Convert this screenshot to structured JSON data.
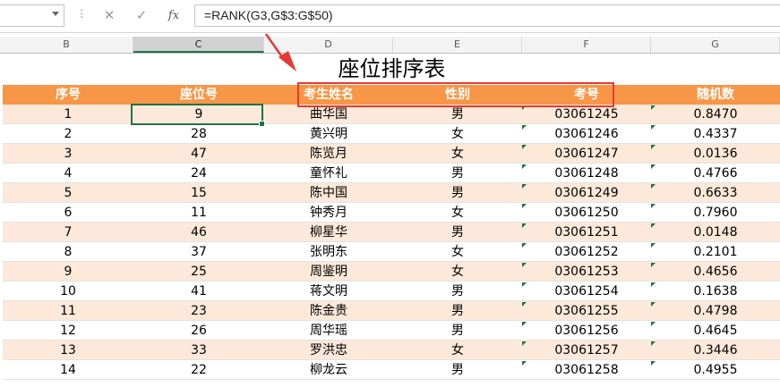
{
  "formula_bar": {
    "name_box": "",
    "cancel_icon": "✕",
    "enter_icon": "✓",
    "fx_label": "fx",
    "formula": "=RANK(G3,G$3:G$50)"
  },
  "columns": [
    "B",
    "C",
    "D",
    "E",
    "F",
    "G"
  ],
  "sheet": {
    "title": "座位排序表",
    "headers": [
      "序号",
      "座位号",
      "考生姓名",
      "性别",
      "考号",
      "随机数"
    ],
    "rows": [
      [
        "1",
        "9",
        "曲华国",
        "男",
        "03061245",
        "0.8470"
      ],
      [
        "2",
        "28",
        "黄兴明",
        "女",
        "03061246",
        "0.4337"
      ],
      [
        "3",
        "47",
        "陈览月",
        "女",
        "03061247",
        "0.0136"
      ],
      [
        "4",
        "24",
        "童怀礼",
        "男",
        "03061248",
        "0.4766"
      ],
      [
        "5",
        "15",
        "陈中国",
        "男",
        "03061249",
        "0.6633"
      ],
      [
        "6",
        "11",
        "钟秀月",
        "女",
        "03061250",
        "0.7960"
      ],
      [
        "7",
        "46",
        "柳星华",
        "男",
        "03061251",
        "0.0148"
      ],
      [
        "8",
        "37",
        "张明东",
        "女",
        "03061252",
        "0.2101"
      ],
      [
        "9",
        "25",
        "周鉴明",
        "女",
        "03061253",
        "0.4656"
      ],
      [
        "10",
        "41",
        "蒋文明",
        "男",
        "03061254",
        "0.1638"
      ],
      [
        "11",
        "23",
        "陈金贵",
        "男",
        "03061255",
        "0.4798"
      ],
      [
        "12",
        "26",
        "周华瑶",
        "男",
        "03061256",
        "0.4645"
      ],
      [
        "13",
        "33",
        "罗洪忠",
        "女",
        "03061257",
        "0.3446"
      ],
      [
        "14",
        "22",
        "柳龙云",
        "男",
        "03061258",
        "0.4955"
      ]
    ]
  },
  "colors": {
    "header_fill": "#f79646",
    "band_fill": "#fde9d9",
    "selection": "#217346",
    "annotation": "#e53935"
  }
}
